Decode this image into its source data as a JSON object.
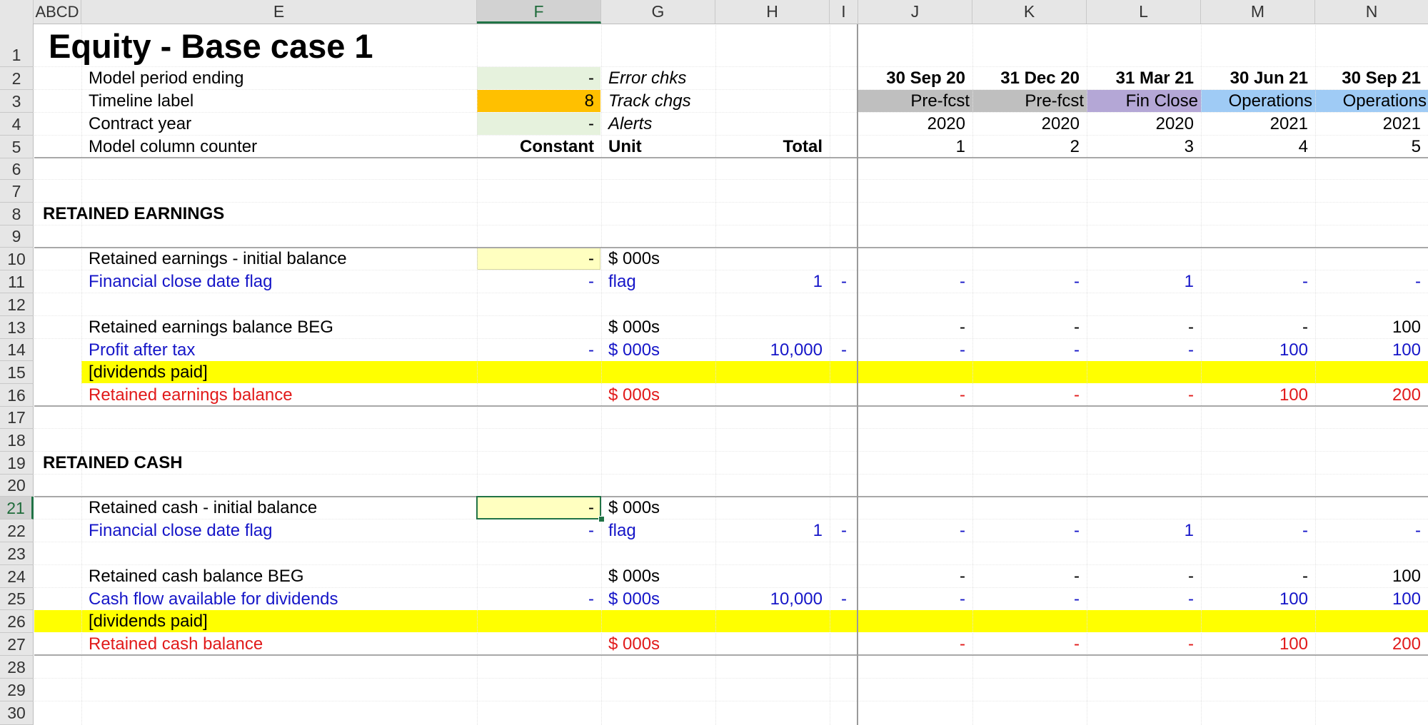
{
  "colors": {
    "yellow_band": "#ffff00",
    "input_fill": "#ffffc0",
    "timeline_fill": "#ffc000",
    "light_green": "#e6f2dd",
    "prefcst": "#bfbfbf",
    "finclose": "#b4a7d6",
    "operations": "#9fcbf5",
    "blue_text": "#1515c8",
    "red_text": "#e11a1a"
  },
  "columns": [
    "ABCD",
    "E",
    "F",
    "G",
    "H",
    "I",
    "J",
    "K",
    "L",
    "M",
    "N"
  ],
  "rows": [
    "1",
    "2",
    "3",
    "4",
    "5",
    "6",
    "7",
    "8",
    "9",
    "10",
    "11",
    "12",
    "13",
    "14",
    "15",
    "16",
    "17",
    "18",
    "19",
    "20",
    "21",
    "22",
    "23",
    "24",
    "25",
    "26",
    "27",
    "28",
    "29",
    "30"
  ],
  "title": "Equity - Base case 1",
  "header": {
    "model_period_ending": "Model period ending",
    "model_period_ending_value": "-",
    "timeline_label": "Timeline label",
    "timeline_label_value": "8",
    "contract_year": "Contract year",
    "contract_year_value": "-",
    "model_column_counter": "Model column counter",
    "error_chks": "Error chks",
    "track_chgs": "Track chgs",
    "alerts": "Alerts",
    "constant": "Constant",
    "unit": "Unit",
    "total": "Total"
  },
  "periods": [
    {
      "date": "30 Sep 20",
      "phase": "Pre-fcst",
      "year": "2020",
      "counter": "1"
    },
    {
      "date": "31 Dec 20",
      "phase": "Pre-fcst",
      "year": "2020",
      "counter": "2"
    },
    {
      "date": "31 Mar 21",
      "phase": "Fin Close",
      "year": "2020",
      "counter": "3"
    },
    {
      "date": "30 Jun 21",
      "phase": "Operations",
      "year": "2021",
      "counter": "4"
    },
    {
      "date": "30 Sep 21",
      "phase": "Operations",
      "year": "2021",
      "counter": "5"
    }
  ],
  "sections": {
    "retained_earnings": {
      "heading": "RETAINED EARNINGS",
      "initial_label": "Retained earnings - initial balance",
      "initial_value": "-",
      "initial_unit": "$ 000s",
      "flag_label": "Financial close date flag",
      "flag_const": "-",
      "flag_unit": "flag",
      "flag_total": "1",
      "flag_i": "-",
      "flag_values": [
        "-",
        "-",
        "1",
        "-",
        "-"
      ],
      "beg_label": "Retained earnings balance BEG",
      "beg_unit": "$ 000s",
      "beg_values": [
        "-",
        "-",
        "-",
        "-",
        "100"
      ],
      "flow_label": "Profit after tax",
      "flow_const": "-",
      "flow_unit": "$ 000s",
      "flow_total": "10,000",
      "flow_i": "-",
      "flow_values": [
        "-",
        "-",
        "-",
        "100",
        "100"
      ],
      "dividends_label": "[dividends paid]",
      "balance_label": "Retained earnings balance",
      "balance_unit": "$ 000s",
      "balance_values": [
        "-",
        "-",
        "-",
        "100",
        "200"
      ]
    },
    "retained_cash": {
      "heading": "RETAINED CASH",
      "initial_label": "Retained cash - initial balance",
      "initial_value": "-",
      "initial_unit": "$ 000s",
      "flag_label": "Financial close date flag",
      "flag_const": "-",
      "flag_unit": "flag",
      "flag_total": "1",
      "flag_i": "-",
      "flag_values": [
        "-",
        "-",
        "1",
        "-",
        "-"
      ],
      "beg_label": "Retained cash balance BEG",
      "beg_unit": "$ 000s",
      "beg_values": [
        "-",
        "-",
        "-",
        "-",
        "100"
      ],
      "flow_label": "Cash flow available for dividends",
      "flow_const": "-",
      "flow_unit": "$ 000s",
      "flow_total": "10,000",
      "flow_i": "-",
      "flow_values": [
        "-",
        "-",
        "-",
        "100",
        "100"
      ],
      "dividends_label": "[dividends paid]",
      "balance_label": "Retained cash balance",
      "balance_unit": "$ 000s",
      "balance_values": [
        "-",
        "-",
        "-",
        "100",
        "200"
      ]
    }
  }
}
